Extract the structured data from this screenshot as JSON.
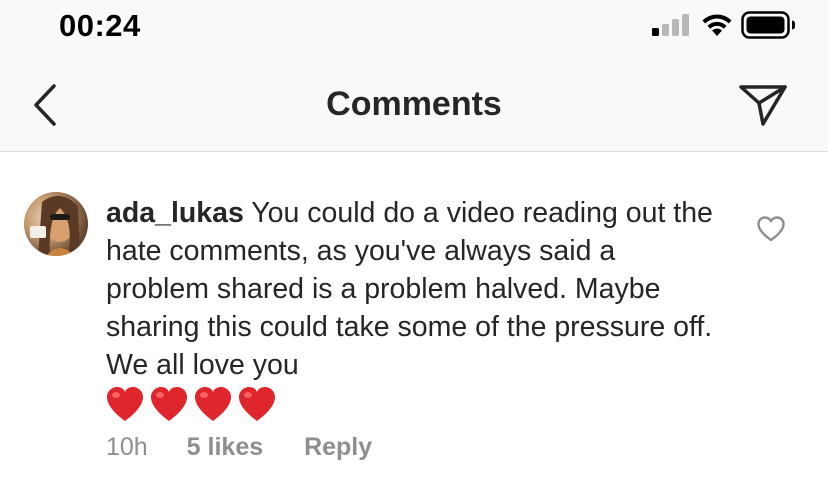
{
  "status_bar": {
    "time": "00:24",
    "signal_icon": "cellular-signal-icon",
    "wifi_icon": "wifi-icon",
    "battery_icon": "battery-icon"
  },
  "nav_bar": {
    "title": "Comments",
    "back_icon": "chevron-left-icon",
    "share_icon": "paper-plane-icon"
  },
  "comment": {
    "username": "ada_lukas",
    "text": "You could do a video reading out the hate comments, as you've always said a problem shared is a problem halved. Maybe sharing this could take some of the pressure off. We all love you",
    "emoji_count": 4,
    "emoji": "red-heart",
    "time_ago": "10h",
    "likes": "5 likes",
    "reply_label": "Reply",
    "like_icon": "heart-outline-icon"
  },
  "colors": {
    "bar_background": "#f9f9f9",
    "text_primary": "#262626",
    "text_secondary": "#8e8e8e",
    "heart_red": "#e0262d",
    "divider": "#dbdbdb"
  }
}
